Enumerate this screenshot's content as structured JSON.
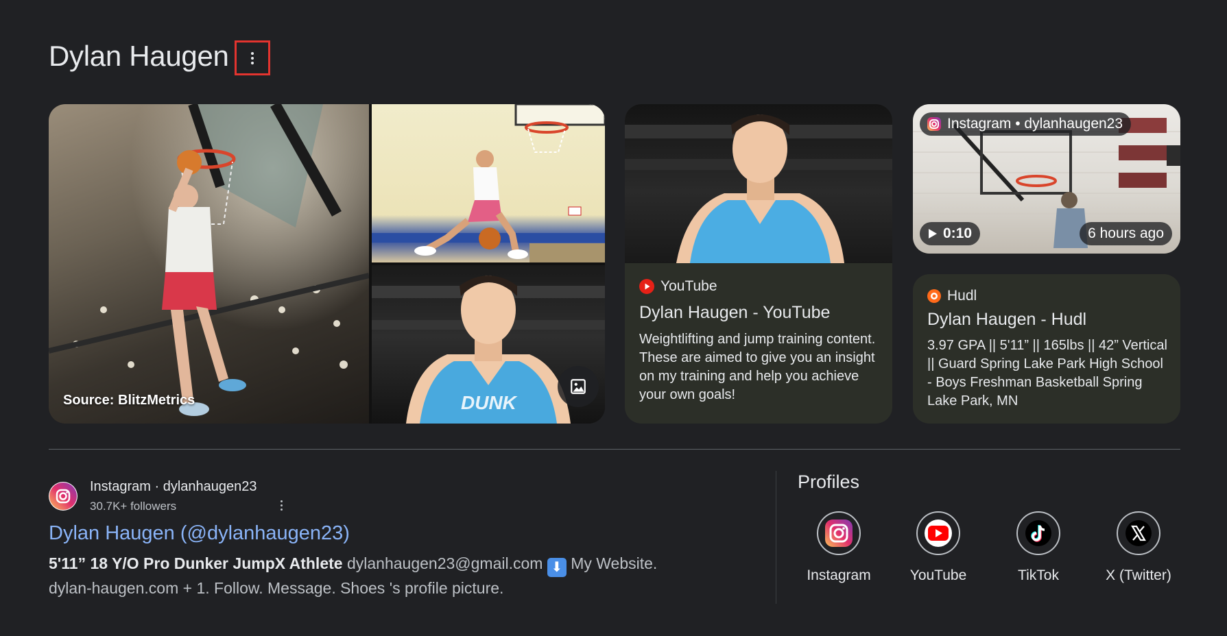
{
  "header": {
    "title": "Dylan Haugen"
  },
  "images": {
    "source_label": "Source: BlitzMetrics"
  },
  "youtube_card": {
    "source": "YouTube",
    "title": "Dylan Haugen - YouTube",
    "description": "Weightlifting and jump training content. These are aimed to give you an insight on my training and help you achieve your own goals!"
  },
  "instagram_video": {
    "source": "Instagram • dylanhaugen23",
    "duration": "0:10",
    "posted": "6 hours ago"
  },
  "hudl_card": {
    "source": "Hudl",
    "title": "Dylan Haugen - Hudl",
    "description": "3.97 GPA || 5'11” || 165lbs || 42” Vertical || Guard Spring Lake Park High School - Boys Freshman Basketball Spring Lake Park, MN"
  },
  "result": {
    "site": "Instagram · dylanhaugen23",
    "followers": "30.7K+ followers",
    "title": "Dylan Haugen (@dylanhaugen23)",
    "snippet_bold": "5'11” 18 Y/O Pro Dunker JumpX Athlete",
    "snippet_rest": " dylanhaugen23@gmail.com ",
    "snippet_emoji": "⬇",
    "snippet_after_emoji": " My Website.",
    "snippet_line2": "dylan-haugen.com + 1. Follow. Message. Shoes 's profile picture."
  },
  "profiles": {
    "heading": "Profiles",
    "items": [
      {
        "label": "Instagram",
        "icon": "instagram-icon"
      },
      {
        "label": "YouTube",
        "icon": "youtube-icon"
      },
      {
        "label": "TikTok",
        "icon": "tiktok-icon"
      },
      {
        "label": "X (Twitter)",
        "icon": "x-twitter-icon"
      }
    ]
  },
  "colors": {
    "background": "#202124",
    "link": "#8ab4f8",
    "card": "#2c2f28",
    "highlight_box": "#e3342f"
  }
}
